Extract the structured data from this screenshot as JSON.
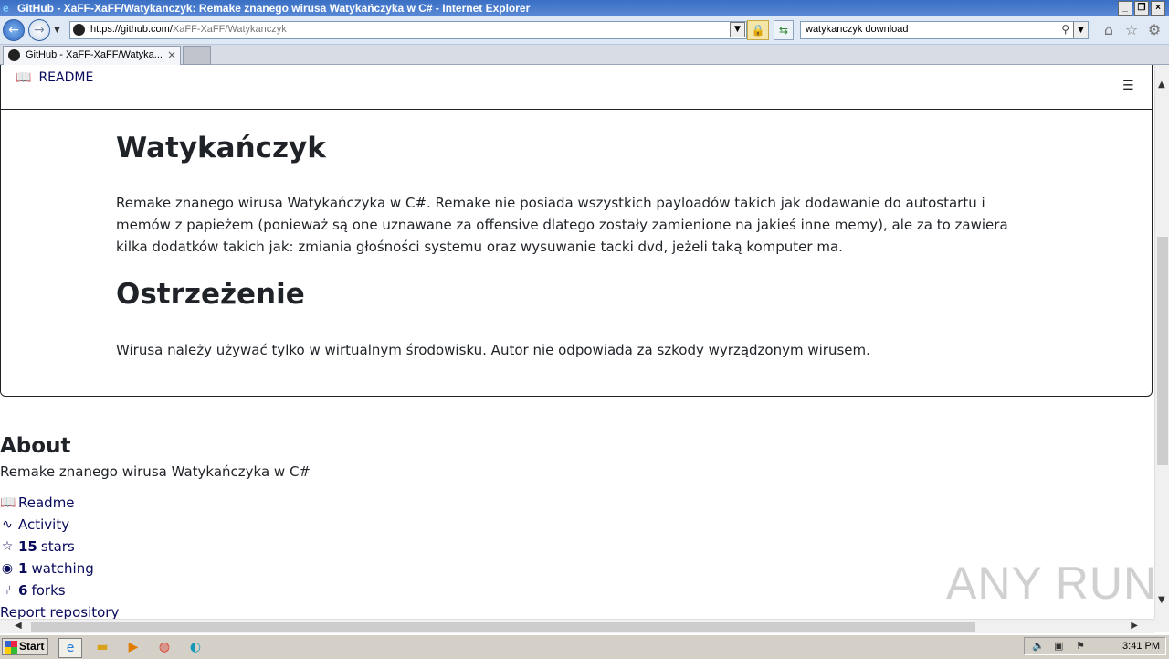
{
  "window": {
    "title": "GitHub - XaFF-XaFF/Watykanczyk: Remake znanego wirusa Watykańczyka w C# - Internet Explorer"
  },
  "address_bar": {
    "url_prefix": "https://github.com/",
    "url_path": "XaFF-XaFF/Watykanczyk"
  },
  "search": {
    "value": "watykanczyk download"
  },
  "tabs": [
    {
      "label": "GitHub - XaFF-XaFF/Watyka...",
      "close": "×"
    }
  ],
  "readme": {
    "tab_label": "README",
    "title": "Watykańczyk",
    "intro": "Remake znanego wirusa Watykańczyka w C#. Remake nie posiada wszystkich payloadów takich jak dodawanie do autostartu i memów z papieżem (ponieważ są one uznawane za offensive dlatego zostały zamienione na jakieś inne memy), ale za to zawiera kilka dodatków takich jak: zmiania głośności systemu oraz wysuwanie tacki dvd, jeżeli taką komputer ma.",
    "warning_title": "Ostrzeżenie",
    "warning_text": "Wirusa należy używać tylko w wirtualnym środowisku. Autor nie odpowiada za szkody wyrządzonym wirusem."
  },
  "about": {
    "title": "About",
    "description": "Remake znanego wirusa Watykańczyka w C#",
    "readme_link": "Readme",
    "activity_link": "Activity",
    "stars_count": "15",
    "stars_label": "stars",
    "watching_count": "1",
    "watching_label": "watching",
    "forks_count": "6",
    "forks_label": "forks",
    "report_link": "Report repository"
  },
  "watermark": "ANY RUN",
  "taskbar": {
    "start_label": "Start",
    "clock": "3:41 PM"
  }
}
